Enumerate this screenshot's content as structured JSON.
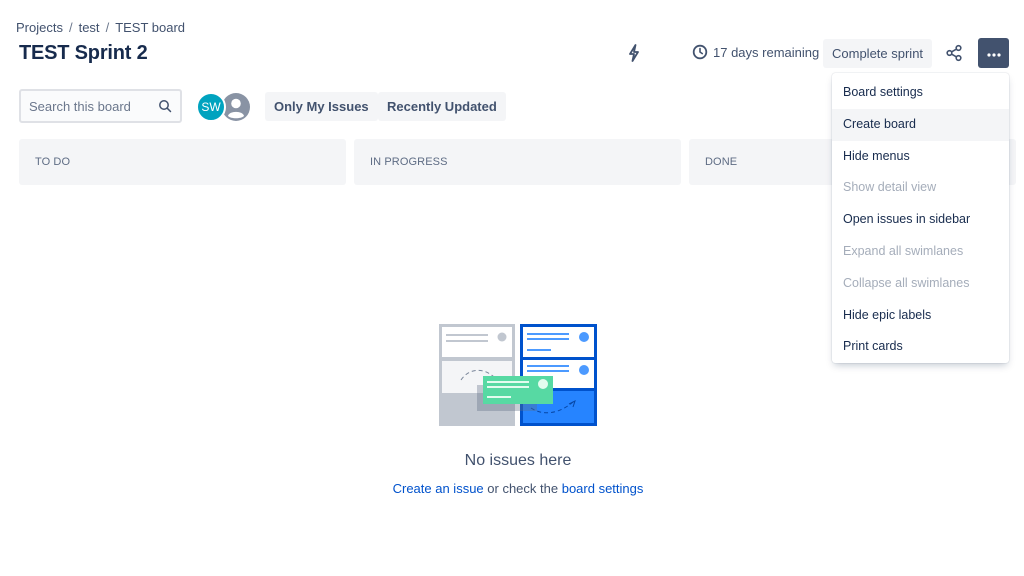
{
  "breadcrumb": {
    "items": [
      "Projects",
      "test",
      "TEST board"
    ],
    "separator": "/"
  },
  "page_title": "TEST Sprint 2",
  "header": {
    "remaining_text": "17 days remaining",
    "complete_sprint_label": "Complete sprint",
    "icons": [
      "power-icon",
      "clock-icon",
      "share-icon",
      "more-icon"
    ]
  },
  "search": {
    "placeholder": "Search this board",
    "value": ""
  },
  "avatars": {
    "user_initials": "SW",
    "user_color": "#00a3bf"
  },
  "quick_filters": {
    "only_my_issues": "Only My Issues",
    "recently_updated": "Recently Updated"
  },
  "columns": [
    {
      "label": "TO DO"
    },
    {
      "label": "IN PROGRESS"
    },
    {
      "label": "DONE"
    }
  ],
  "empty_state": {
    "title": "No issues here",
    "create_link": "Create an issue",
    "middle_text": " or check the ",
    "settings_link": "board settings"
  },
  "menu": {
    "items": [
      {
        "label": "Board settings",
        "state": "normal"
      },
      {
        "label": "Create board",
        "state": "hover"
      },
      {
        "label": "Hide menus",
        "state": "normal"
      },
      {
        "label": "Show detail view",
        "state": "disabled"
      },
      {
        "label": "Open issues in sidebar",
        "state": "normal"
      },
      {
        "label": "Expand all swimlanes",
        "state": "disabled"
      },
      {
        "label": "Collapse all swimlanes",
        "state": "disabled"
      },
      {
        "label": "Hide epic labels",
        "state": "normal"
      },
      {
        "label": "Print cards",
        "state": "normal"
      }
    ]
  },
  "colors": {
    "text_primary": "#172b4d",
    "text_secondary": "#42526e",
    "link": "#0052cc",
    "more_button_bg": "#42526e",
    "column_bg": "#f4f5f7"
  }
}
